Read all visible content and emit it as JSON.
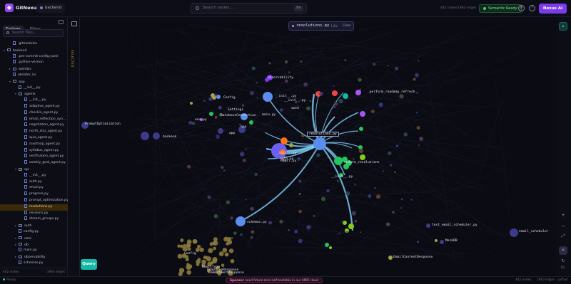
{
  "header": {
    "app_title": "GitNexus",
    "repo": "backend",
    "search_placeholder": "Search nodes...",
    "search_kbd": "⌘K",
    "nodes_stat": "442 nodes",
    "edges_stat": "1963 edges",
    "semantic_label": "Semantic Ready",
    "ai_label": "Nexus AI"
  },
  "sidebar": {
    "tabs": [
      "Explorer",
      "Filters"
    ],
    "filter_placeholder": "Search files...",
    "items": [
      {
        "label": ".gitmodules",
        "kind": "file",
        "depth": 1,
        "open": false
      },
      {
        "label": "backend",
        "kind": "folder",
        "depth": 0,
        "open": true
      },
      {
        "label": ".pre-commit-config.yaml",
        "kind": "file",
        "depth": 1,
        "open": false
      },
      {
        "label": ".python-version",
        "kind": "file",
        "depth": 1,
        "open": false
      },
      {
        "label": "alembic",
        "kind": "folder",
        "depth": 1,
        "open": false
      },
      {
        "label": "alembic.ini",
        "kind": "file",
        "depth": 1,
        "open": false
      },
      {
        "label": "app",
        "kind": "folder",
        "depth": 1,
        "open": true
      },
      {
        "label": "__init__.py",
        "kind": "file",
        "depth": 2,
        "open": false
      },
      {
        "label": "agents",
        "kind": "folder",
        "depth": 2,
        "open": true
      },
      {
        "label": "__init__.py",
        "kind": "file",
        "depth": 3,
        "open": false
      },
      {
        "label": "adaptive_agent.py",
        "kind": "file",
        "depth": 3,
        "open": false
      },
      {
        "label": "checkin_agent.py",
        "kind": "file",
        "depth": 3,
        "open": false
      },
      {
        "label": "email_reflection_syn...",
        "kind": "file",
        "depth": 3,
        "open": false
      },
      {
        "label": "negotiation_agent.py",
        "kind": "file",
        "depth": 3,
        "open": false
      },
      {
        "label": "north_star_agent.py",
        "kind": "file",
        "depth": 3,
        "open": false
      },
      {
        "label": "quiz_agent.py",
        "kind": "file",
        "depth": 3,
        "open": false
      },
      {
        "label": "roadmap_agent.py",
        "kind": "file",
        "depth": 3,
        "open": false
      },
      {
        "label": "syllabus_agent.py",
        "kind": "file",
        "depth": 3,
        "open": false
      },
      {
        "label": "verification_agent.py",
        "kind": "file",
        "depth": 3,
        "open": false
      },
      {
        "label": "weekly_goal_agent.py",
        "kind": "file",
        "depth": 3,
        "open": false
      },
      {
        "label": "api",
        "kind": "folder",
        "depth": 2,
        "open": true
      },
      {
        "label": "__init__.py",
        "kind": "file",
        "depth": 3,
        "open": false
      },
      {
        "label": "auth.py",
        "kind": "file",
        "depth": 3,
        "open": false
      },
      {
        "label": "email.py",
        "kind": "file",
        "depth": 3,
        "open": false
      },
      {
        "label": "progress.py",
        "kind": "file",
        "depth": 3,
        "open": false
      },
      {
        "label": "prompt_optimization.py",
        "kind": "file",
        "depth": 3,
        "open": false
      },
      {
        "label": "resolutions.py",
        "kind": "file",
        "depth": 3,
        "open": false,
        "selected": true
      },
      {
        "label": "sessions.py",
        "kind": "file",
        "depth": 3,
        "open": false
      },
      {
        "label": "stream_groups.py",
        "kind": "file",
        "depth": 3,
        "open": false
      },
      {
        "label": "auth",
        "kind": "folder",
        "depth": 2,
        "open": false
      },
      {
        "label": "config.py",
        "kind": "file",
        "depth": 2,
        "open": false
      },
      {
        "label": "core",
        "kind": "folder",
        "depth": 2,
        "open": false
      },
      {
        "label": "db",
        "kind": "folder",
        "depth": 2,
        "open": false
      },
      {
        "label": "main.py",
        "kind": "file",
        "depth": 2,
        "open": false
      },
      {
        "label": "observability",
        "kind": "folder",
        "depth": 2,
        "open": false
      },
      {
        "label": "schemas.py",
        "kind": "file",
        "depth": 2,
        "open": false
      }
    ],
    "footer_left": "442 nodes",
    "footer_right": "1963 edges",
    "vertical_label": "SELECTED"
  },
  "graph": {
    "selection_name": "resolutions.py",
    "selection_sub": "1 file",
    "clear_label": "Clear",
    "node_card": "resolutions.py",
    "query_label": "Query",
    "labels": [
      "observability",
      "Config",
      "__init__.py",
      "__init__.py",
      "auth",
      "Settings",
      "DatabaseConnection",
      "main.py",
      "env.py",
      "app",
      "app",
      "backend",
      "PromptOptimization",
      "_perform_roadmap_refresh",
      "schemas.py",
      "update_resolutions",
      "test_email_scheduler.py",
      "email_scheduler",
      "MockDB",
      "EmailContentResponse",
      "Config",
      "EmailType",
      "AdaptiveResponse",
      "CommitmentResponse",
      "__init__.py",
      "auth.py",
      "email.py",
      "__init__.py"
    ],
    "colors": {
      "file": "#5b8def",
      "function": "#22c55e",
      "class": "#a3a34a",
      "selected": "#f97316",
      "edge": "#7dd3fc"
    }
  },
  "rtools": [
    "pin-icon",
    "zoom-in-icon",
    "zoom-out-icon",
    "fit-icon",
    "layout-icon",
    "refresh-icon",
    "play-icon"
  ],
  "statusbar": {
    "ready": "Ready",
    "sponsor_prefix": "Sponsor",
    "sponsor_text": "need future-zero self-hostable in our AMD cloud",
    "right1": "442 nodes",
    "right2": "1963 edges",
    "right3": "python"
  }
}
